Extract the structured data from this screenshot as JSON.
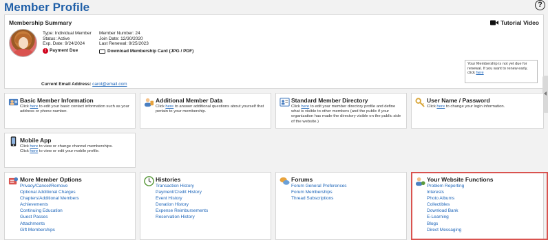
{
  "page": {
    "title": "Member Profile",
    "help_symbol": "?"
  },
  "summary": {
    "title": "Membership Summary",
    "tutorial_label": "Tutorial Video",
    "type": "Type: Individual Member",
    "status": "Status: Active",
    "exp_date": "Exp. Date: 9/24/2024",
    "payment_due": "Payment Due",
    "member_number": "Member Number: 24",
    "join_date": "Join Date: 12/30/2020",
    "last_renewal": "Last Renewal: 9/25/2023",
    "download_card": "Download Membership Card (JPG / PDF)",
    "renew_notice": "Your Membership is not yet due for renewal. If you want to renew early, click ",
    "renew_link": "here",
    "email_label": "Current Email Address: ",
    "email_value": "carol@email.com"
  },
  "tiles": {
    "basic": {
      "title": "Basic Member Information",
      "desc_pre": "Click ",
      "desc_link": "here",
      "desc_post": " to edit your basic contact information such as your address or phone number.",
      "icon": "person-card-icon"
    },
    "additional": {
      "title": "Additional Member Data",
      "desc_pre": "Click ",
      "desc_link": "here",
      "desc_post": " to answer additional questions about yourself that pertain to your membership.",
      "icon": "person-data-icon"
    },
    "directory": {
      "title": "Standard Member Directory",
      "desc_pre": "Click ",
      "desc_link": "here",
      "desc_post": " to edit your member directory profile and define what is visible to other members (and the public if your organization has made the directory visible on the public side of the website.)",
      "icon": "directory-icon"
    },
    "username": {
      "title": "User Name / Password",
      "desc_pre": "Click ",
      "desc_link": "here",
      "desc_post": " to change your login information.",
      "icon": "key-icon"
    },
    "mobile": {
      "title": "Mobile App",
      "desc_pre": "Click ",
      "desc_link": "here",
      "desc_post": " to view or change channel memberships.",
      "desc2_pre": "Click ",
      "desc2_link": "here",
      "desc2_post": " to view or edit your mobile profile.",
      "icon": "phone-icon"
    },
    "more": {
      "title": "More Member Options",
      "icon": "options-icon",
      "links": [
        "Privacy/Cancel/Remove",
        "Optional Additional Charges",
        "Chapters/Additional Members",
        "Achievements",
        "Continuing Education",
        "Guest Passes",
        "Attachments",
        "Gift Memberships"
      ]
    },
    "histories": {
      "title": "Histories",
      "icon": "clock-icon",
      "links": [
        "Transaction History",
        "Payment/Credit History",
        "Event History",
        "Donation History",
        "Expense Reimbursements",
        "Reservation History"
      ]
    },
    "forums": {
      "title": "Forums",
      "icon": "chat-bubbles-icon",
      "links": [
        "Forum General Preferences",
        "Forum Memberships",
        "Thread Subscriptions"
      ]
    },
    "website": {
      "title": "Your Website Functions",
      "icon": "person-web-icon",
      "links": [
        "Problem Reporting",
        "Interests",
        "Photo Albums",
        "Collectibles",
        "Download Bank",
        "E-Learning",
        "Blogs",
        "Direct Messaging"
      ]
    }
  },
  "colors": {
    "accent": "#1f5fa8",
    "link": "#1a63b8",
    "warning": "#d0021b",
    "highlight": "#d9534f"
  }
}
